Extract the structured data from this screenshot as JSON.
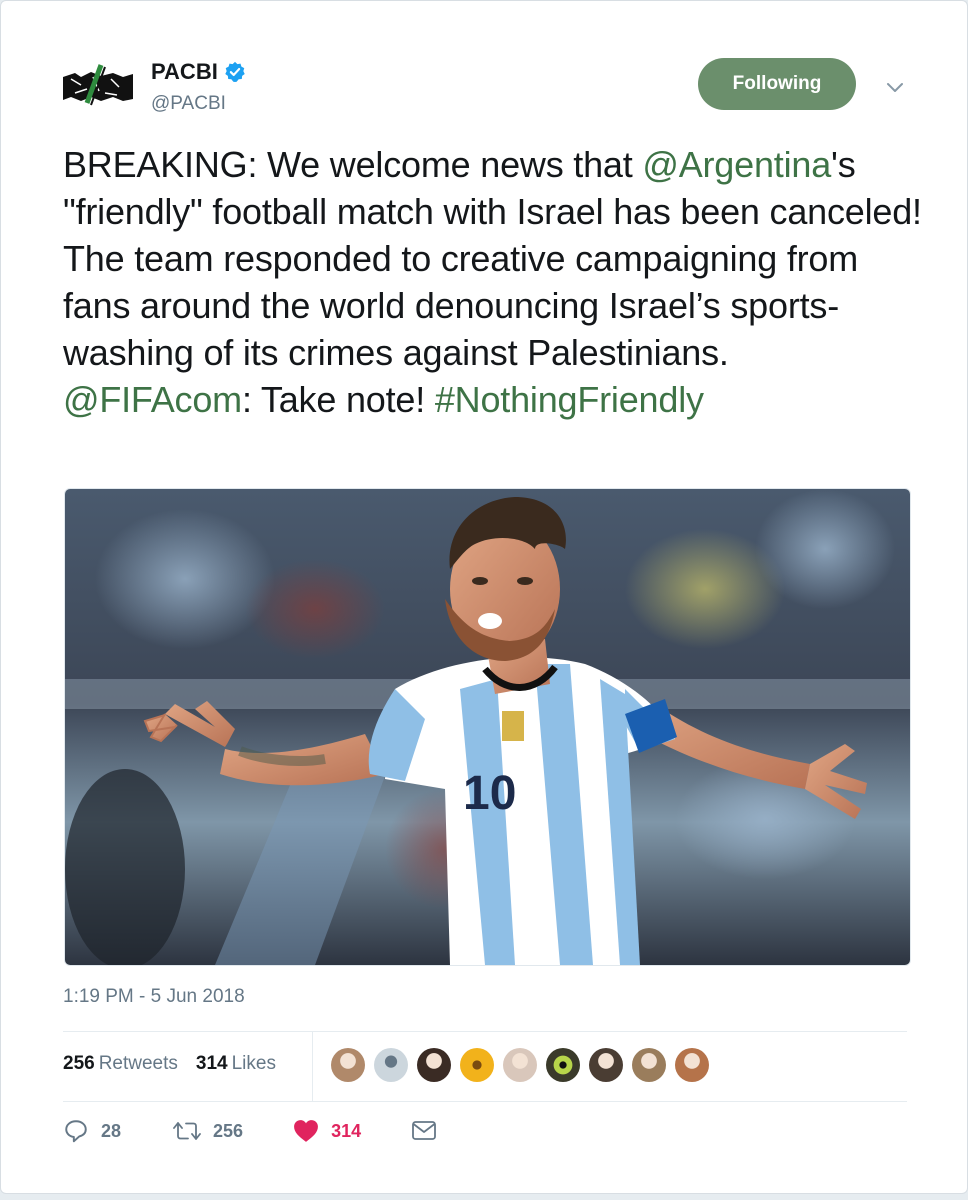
{
  "account": {
    "name": "PACBI",
    "handle": "@PACBI",
    "verified": true
  },
  "follow_button_label": "Following",
  "tweet": {
    "segments": [
      {
        "text": "BREAKING: We welcome news that ",
        "link": false
      },
      {
        "text": "@Argentina",
        "link": true
      },
      {
        "text": "'s \"friendly\" football match with Israel has been canceled! The team responded to creative campaigning from fans around the world denouncing Israel’s sports-washing of its crimes against Palestinians. ",
        "link": false
      },
      {
        "text": "@FIFAcom",
        "link": true
      },
      {
        "text": ": Take note! ",
        "link": false
      },
      {
        "text": "#NothingFriendly",
        "link": true
      }
    ]
  },
  "media": {
    "kind": "photo",
    "subject": "football-player-celebrating",
    "shirt_number": "10"
  },
  "timestamp": "1:19 PM - 5 Jun 2018",
  "stats": {
    "retweets_count": "256",
    "retweets_label": "Retweets",
    "likes_count": "314",
    "likes_label": "Likes"
  },
  "actions": {
    "reply_count": "28",
    "retweet_count": "256",
    "like_count": "314"
  },
  "icons": {
    "reply": "reply-icon",
    "retweet": "retweet-icon",
    "like": "heart-icon",
    "message": "envelope-icon",
    "verified": "verified-badge-icon",
    "caret": "chevron-down-icon"
  },
  "colors": {
    "link": "#3e7346",
    "follow_button": "#6b8f6c",
    "like": "#e0245e",
    "muted": "#657786",
    "verified": "#1da1f2"
  },
  "likers": [
    "#b0896a",
    "#aab8c2",
    "#3a2b24",
    "#f2b21b",
    "#d9c7bb",
    "#8fb03c",
    "#4a3d33",
    "#9a7d5c",
    "#b5734a"
  ]
}
